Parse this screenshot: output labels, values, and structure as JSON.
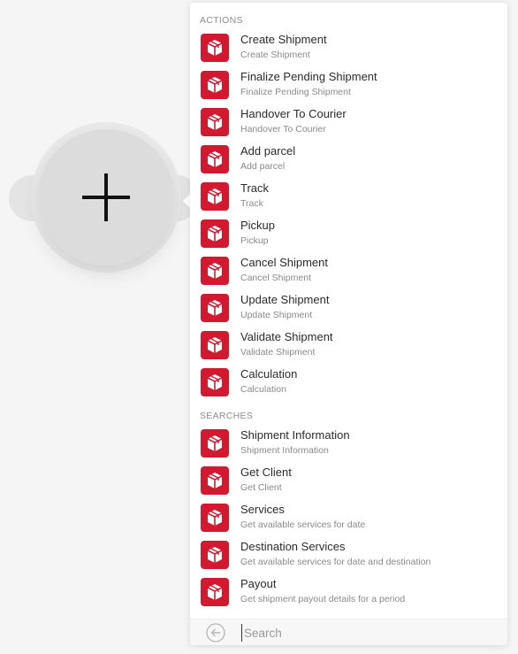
{
  "panel": {
    "sections": [
      {
        "header": "ACTIONS",
        "items": [
          {
            "title": "Create Shipment",
            "description": "Create Shipment",
            "icon": "parcel-box-icon"
          },
          {
            "title": "Finalize Pending Shipment",
            "description": "Finalize Pending Shipment",
            "icon": "parcel-box-icon"
          },
          {
            "title": "Handover To Courier",
            "description": "Handover To Courier",
            "icon": "parcel-box-icon"
          },
          {
            "title": "Add parcel",
            "description": "Add parcel",
            "icon": "parcel-box-icon"
          },
          {
            "title": "Track",
            "description": "Track",
            "icon": "parcel-box-icon"
          },
          {
            "title": "Pickup",
            "description": "Pickup",
            "icon": "parcel-box-icon"
          },
          {
            "title": "Cancel Shipment",
            "description": "Cancel Shipment",
            "icon": "parcel-box-icon"
          },
          {
            "title": "Update Shipment",
            "description": "Update Shipment",
            "icon": "parcel-box-icon"
          },
          {
            "title": "Validate Shipment",
            "description": "Validate Shipment",
            "icon": "parcel-box-icon"
          },
          {
            "title": "Calculation",
            "description": "Calculation",
            "icon": "parcel-box-icon"
          }
        ]
      },
      {
        "header": "SEARCHES",
        "items": [
          {
            "title": "Shipment Information",
            "description": "Shipment Information",
            "icon": "parcel-box-icon"
          },
          {
            "title": "Get Client",
            "description": "Get Client",
            "icon": "parcel-box-icon"
          },
          {
            "title": "Services",
            "description": "Get available services for date",
            "icon": "parcel-box-icon"
          },
          {
            "title": "Destination Services",
            "description": "Get available services for date and destination",
            "icon": "parcel-box-icon"
          },
          {
            "title": "Payout",
            "description": "Get shipment payout details for a period",
            "icon": "parcel-box-icon"
          }
        ]
      }
    ]
  },
  "search": {
    "placeholder": "Search",
    "value": ""
  },
  "module": {
    "icon": "plus-icon"
  },
  "colors": {
    "brand": "#d21930",
    "canvas": "#f5f5f5",
    "module": "#dcdcdc"
  }
}
